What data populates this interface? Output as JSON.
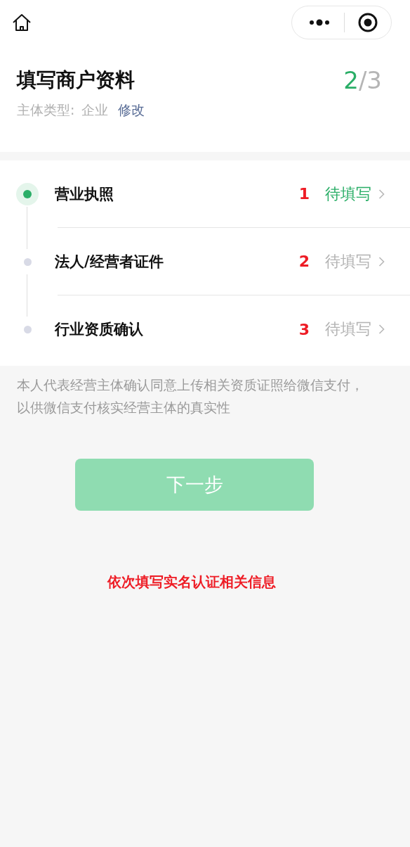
{
  "header": {
    "title": "填写商户资料",
    "progress_current": "2",
    "progress_separator": "/",
    "progress_total": "3",
    "subject_label": "主体类型:",
    "subject_value": "企业",
    "edit_link": "修改"
  },
  "steps": [
    {
      "title": "营业执照",
      "annotation": "1",
      "status": "待填写",
      "selected": true
    },
    {
      "title": "法人/经营者证件",
      "annotation": "2",
      "status": "待填写",
      "selected": false
    },
    {
      "title": "行业资质确认",
      "annotation": "3",
      "status": "待填写",
      "selected": false
    }
  ],
  "consent_note": "本人代表经营主体确认同意上传相关资质证照给微信支付，以供微信支付核实经营主体的真实性",
  "next_button": {
    "label": "下一步",
    "disabled": true
  },
  "annotation_note": "依次填写实名认证相关信息"
}
